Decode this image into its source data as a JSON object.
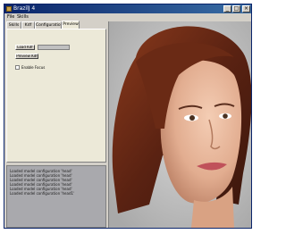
{
  "window": {
    "title": "BrazilJ 4"
  },
  "menu": {
    "items": [
      "File",
      "Skills"
    ]
  },
  "tabs": [
    {
      "label": "Skills",
      "active": false
    },
    {
      "label": "Kdf",
      "active": false
    },
    {
      "label": "Configuration",
      "active": false
    },
    {
      "label": "Preview",
      "active": true
    }
  ],
  "panel": {
    "load_button": "Load Kdf",
    "preview_button": "Preview Kdf",
    "checkbox_label": "Enable Focus",
    "checkbox_checked": false
  },
  "log": {
    "lines": [
      "Loaded model configuration 'head'",
      "Loaded model configuration 'head'",
      "Loaded model configuration 'head'",
      "Loaded model configuration 'head'",
      "Loaded model configuration 'head'",
      "Loaded model configuration 'head1'"
    ]
  },
  "colors": {
    "titlebar": "#0a246a",
    "window_chrome": "#d4d0c8",
    "viewport_bg": "#c8c8c8",
    "hair": "#6a2a15",
    "skin": "#e5b59a"
  }
}
